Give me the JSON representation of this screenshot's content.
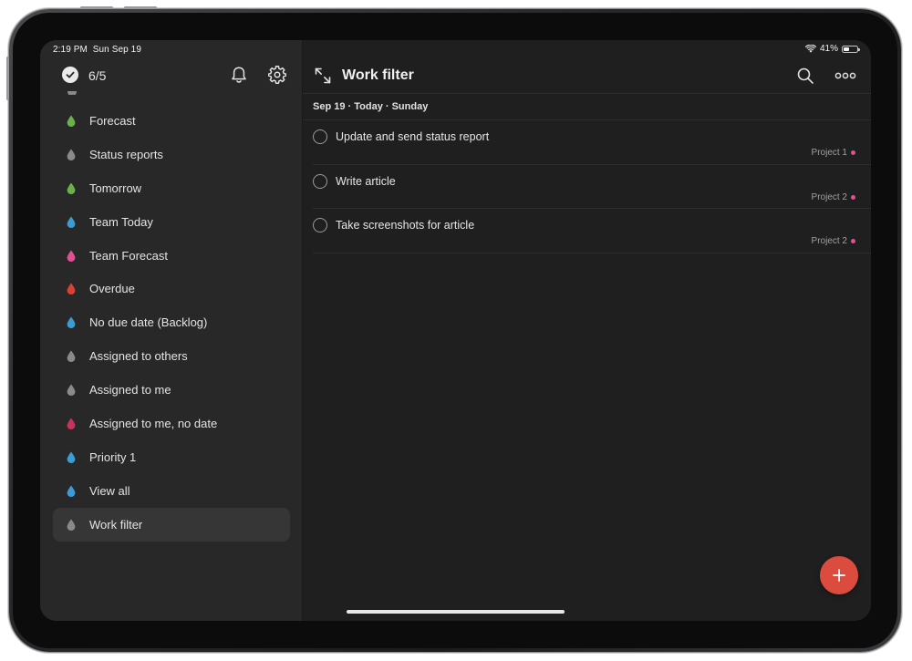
{
  "status_bar": {
    "time": "2:19 PM",
    "date": "Sun Sep 19",
    "battery": "41%",
    "battery_level": 0.41
  },
  "sidebar": {
    "karma": "6/5",
    "items": [
      {
        "label": "Forecast",
        "color": "#6ab04c"
      },
      {
        "label": "Status reports",
        "color": "#8a8a8a"
      },
      {
        "label": "Tomorrow",
        "color": "#6ab04c"
      },
      {
        "label": "Team Today",
        "color": "#3a9bd5"
      },
      {
        "label": "Team Forecast",
        "color": "#e05194"
      },
      {
        "label": "Overdue",
        "color": "#db4035"
      },
      {
        "label": "No due date (Backlog)",
        "color": "#3a9bd5"
      },
      {
        "label": "Assigned to others",
        "color": "#8a8a8a"
      },
      {
        "label": "Assigned to me",
        "color": "#8a8a8a"
      },
      {
        "label": "Assigned to me, no date",
        "color": "#c7325f"
      },
      {
        "label": "Priority 1",
        "color": "#3a9bd5"
      },
      {
        "label": "View all",
        "color": "#3a9bd5"
      },
      {
        "label": "Work filter",
        "color": "#8a8a8a",
        "selected": true
      }
    ]
  },
  "main": {
    "title": "Work filter",
    "section": "Sep 19 · Today · Sunday",
    "tasks": [
      {
        "title": "Update and send status report",
        "project": "Project 1"
      },
      {
        "title": "Write article",
        "project": "Project 2"
      },
      {
        "title": "Take screenshots for article",
        "project": "Project 2"
      }
    ],
    "project_color": "#e05194"
  },
  "colors": {
    "accent": "#dc4c3e",
    "sidebar_bg": "#282828",
    "main_bg": "#1f1f1f"
  },
  "icons": {
    "karma": "check-circle-icon",
    "notifications": "bell-icon",
    "settings": "gear-icon",
    "expand": "expand-arrows-icon",
    "search": "search-icon",
    "more": "more-dots-icon",
    "add": "plus-icon",
    "filter": "drop-icon"
  }
}
